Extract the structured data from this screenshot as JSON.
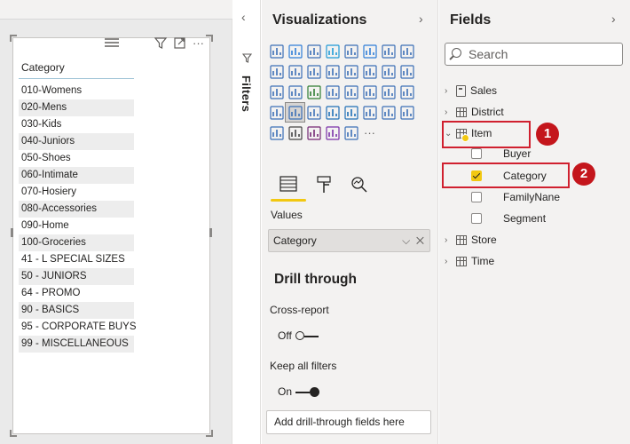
{
  "report": {
    "visual": {
      "header": "Category",
      "icons": [
        "filter-icon",
        "focus-mode-icon",
        "more-options-icon"
      ],
      "rows": [
        "010-Womens",
        "020-Mens",
        "030-Kids",
        "040-Juniors",
        "050-Shoes",
        "060-Intimate",
        "070-Hosiery",
        "080-Accessories",
        "090-Home",
        "100-Groceries",
        "41 - L SPECIAL SIZES",
        "50 - JUNIORS",
        "64 - PROMO",
        "90 - BASICS",
        "95 - CORPORATE BUYS",
        "99 - MISCELLANEOUS"
      ]
    }
  },
  "filters": {
    "label": "Filters",
    "collapse_glyph": "‹",
    "icon": "funnel-icon"
  },
  "visualizations": {
    "title": "Visualizations",
    "expand_glyph": "›",
    "values_label": "Values",
    "well_field": "Category",
    "drill_title": "Drill through",
    "cross_report_label": "Cross-report",
    "cross_report_state": "Off",
    "keep_filters_label": "Keep all filters",
    "keep_filters_state": "On",
    "drill_placeholder": "Add drill-through fields here",
    "more_glyph": "···"
  },
  "fields": {
    "title": "Fields",
    "expand_glyph": "›",
    "search_placeholder": "Search",
    "tables": [
      {
        "name": "Sales",
        "icon": "calculator-icon",
        "expanded": false
      },
      {
        "name": "District",
        "icon": "table-icon",
        "expanded": false
      },
      {
        "name": "Item",
        "icon": "table-icon",
        "expanded": true
      },
      {
        "name": "Store",
        "icon": "table-icon",
        "expanded": false
      },
      {
        "name": "Time",
        "icon": "table-icon",
        "expanded": false
      }
    ],
    "item_fields": [
      {
        "name": "Buyer",
        "checked": false
      },
      {
        "name": "Category",
        "checked": true
      },
      {
        "name": "FamilyNane",
        "checked": false
      },
      {
        "name": "Segment",
        "checked": false
      }
    ]
  },
  "annotations": {
    "step1": "1",
    "step2": "2",
    "color": "#d0202f"
  }
}
